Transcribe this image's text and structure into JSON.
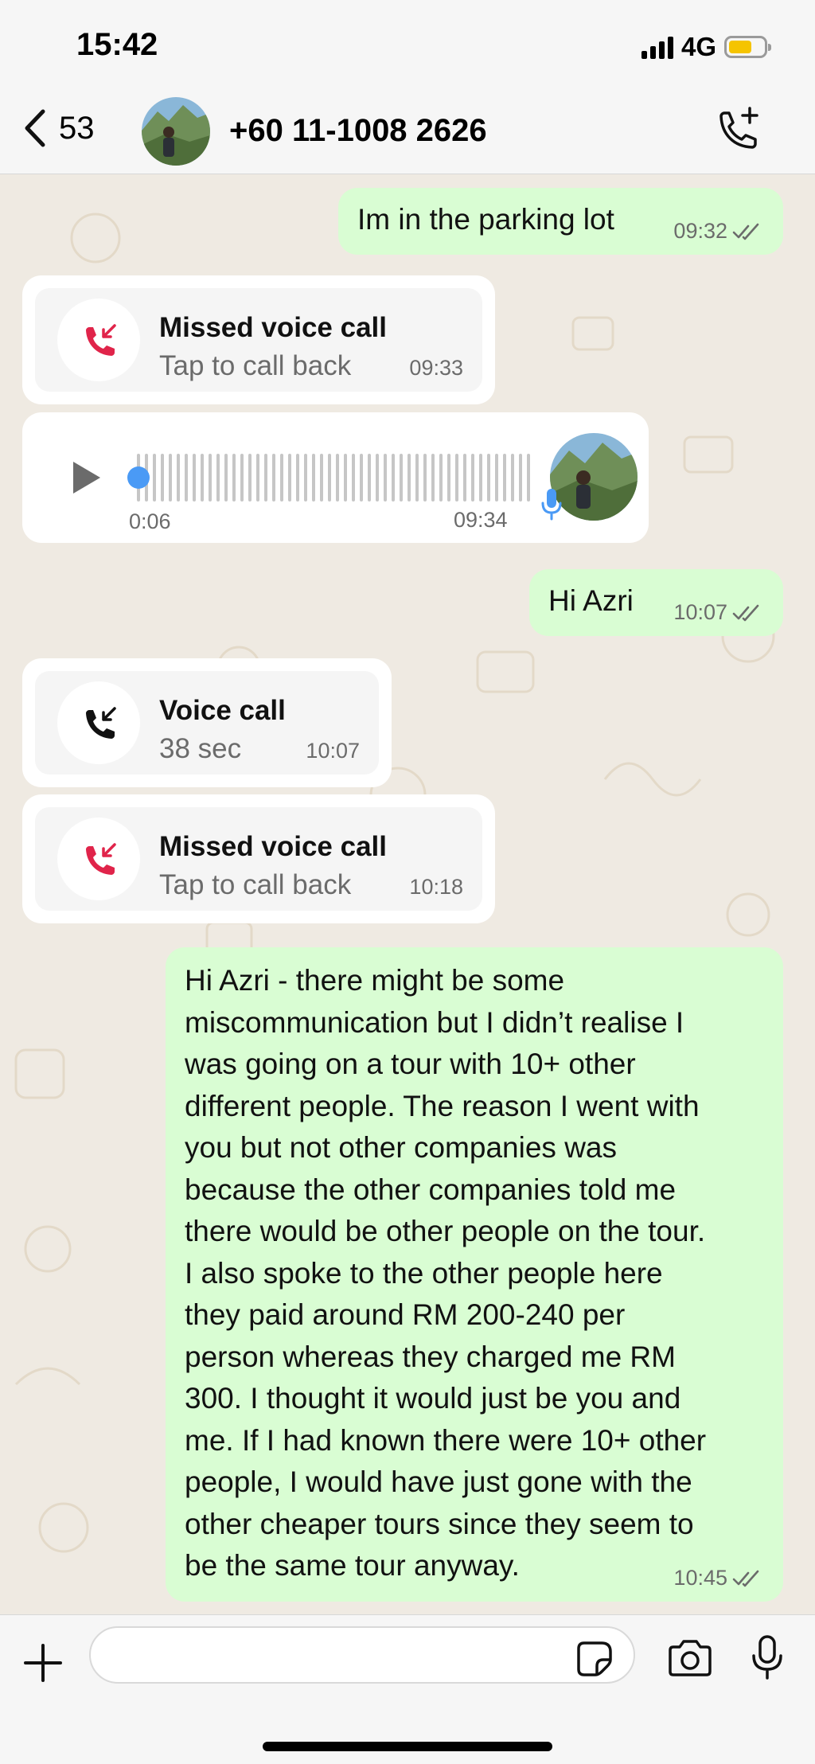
{
  "status_bar": {
    "time": "15:42",
    "network": "4G",
    "icons": [
      "signal-icon",
      "battery-icon"
    ]
  },
  "header": {
    "back_count": "53",
    "contact_name": "+60 11-1008 2626",
    "icons": [
      "chevron-left-icon",
      "avatar",
      "add-call-icon"
    ]
  },
  "messages": [
    {
      "type": "outgoing",
      "text": "Im in the parking lot",
      "time": "09:32",
      "status": "read"
    },
    {
      "type": "missed-call",
      "title": "Missed voice call",
      "subtitle": "Tap to call back",
      "time": "09:33"
    },
    {
      "type": "voice-note",
      "duration": "0:06",
      "time": "09:34",
      "progress": 0
    },
    {
      "type": "outgoing",
      "text": "Hi Azri",
      "time": "10:07",
      "status": "read"
    },
    {
      "type": "voice-call",
      "title": "Voice call",
      "subtitle": "38 sec",
      "time": "10:07"
    },
    {
      "type": "missed-call",
      "title": "Missed voice call",
      "subtitle": "Tap to call back",
      "time": "10:18"
    },
    {
      "type": "outgoing",
      "lines": [
        "Hi Azri - there might be some",
        "miscommunication but I didn’t realise I",
        "was going on a tour with 10+ other",
        "different people. The reason I went with",
        "you but not other companies was",
        "because the other companies told me",
        "there would be other people on the tour.",
        "I also spoke to the other people here",
        "they paid around RM 200-240 per",
        "person whereas they charged me RM",
        "300. I thought it would just be you and",
        "me. If I had known there were 10+ other",
        "people, I would have just gone with the",
        "other cheaper tours since they seem to",
        "be the same tour anyway."
      ],
      "time": "10:45",
      "status": "read"
    }
  ],
  "input": {
    "placeholder": "",
    "value": ""
  },
  "colors": {
    "outgoing_bubble": "#d9fdd3",
    "incoming_bubble": "#ffffff",
    "missed_call_red": "#e0244a",
    "chat_background": "#efeae2",
    "voice_progress_blue": "#4a9af5"
  }
}
